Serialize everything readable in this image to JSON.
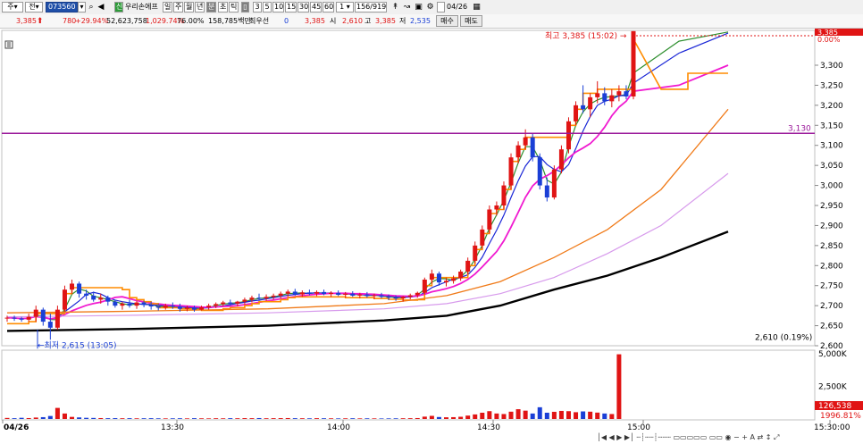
{
  "toolbar": {
    "market": "주",
    "mode": "전",
    "code": "073560",
    "search_icon": "magnifier-icon",
    "speaker_icon": "speaker-icon",
    "badge": "신",
    "stock_name": "우리손에프",
    "periods": [
      "일",
      "주",
      "월",
      "년",
      "분",
      "초",
      "틱"
    ],
    "active_period": "분",
    "page_icon": "page-icon",
    "intervals": [
      "3",
      "5",
      "10",
      "15",
      "30",
      "45",
      "60"
    ],
    "interval_select": "1",
    "count": "156",
    "total": "919",
    "tools": [
      "chart-type-icon",
      "link-icon",
      "save-icon",
      "gear-icon"
    ],
    "checkbox_date": "04/26",
    "calendar_icon": "calendar-icon"
  },
  "quote": {
    "price": "3,385",
    "change": "780",
    "change_pct": "+29.94%",
    "volume": "52,623,758",
    "volume_pct": "1,029.74%",
    "ratio": "76.00%",
    "amount": "158,785백만",
    "priority_label": "최우선",
    "priority_value": "0",
    "last": "3,385",
    "open_label": "시",
    "open": "2,610",
    "high_label": "고",
    "high": "3,385",
    "low_label": "저",
    "low": "2,535",
    "buy_label": "매수",
    "sell_label": "매도"
  },
  "chart_data": {
    "type": "candlestick",
    "date": "04/26",
    "x_ticks": [
      "04/26",
      "13:30",
      "14:00",
      "14:30",
      "15:00",
      "15:30:00"
    ],
    "y_ticks": [
      "3,300",
      "3,250",
      "3,200",
      "3,150",
      "3,100",
      "3,050",
      "3,000",
      "2,950",
      "2,900",
      "2,850",
      "2,800",
      "2,750",
      "2,700",
      "2,650",
      "2,600"
    ],
    "ylim": [
      2600,
      3385
    ],
    "hline": {
      "value": 3130,
      "label": "3,130",
      "color": "#9b1a9b"
    },
    "high_marker": {
      "label": "최고 3,385 (15:02)",
      "value": 3385
    },
    "low_marker": {
      "label": "최저 2,615 (13:05)",
      "value": 2615
    },
    "open_label": "2,610 (0.19%)",
    "top_price_box": "3,385",
    "top_pct_box": "0.00%",
    "volume_ticks": [
      "5,000K",
      "2,500K"
    ],
    "volume_last": "126,538",
    "volume_pct_label": "1996.81%",
    "candles": [
      [
        2668,
        2675,
        2660,
        2670
      ],
      [
        2670,
        2675,
        2662,
        2668
      ],
      [
        2668,
        2672,
        2660,
        2665
      ],
      [
        2665,
        2680,
        2660,
        2672
      ],
      [
        2672,
        2700,
        2660,
        2690
      ],
      [
        2690,
        2695,
        2650,
        2660
      ],
      [
        2660,
        2680,
        2615,
        2645
      ],
      [
        2645,
        2700,
        2640,
        2690
      ],
      [
        2690,
        2750,
        2685,
        2740
      ],
      [
        2740,
        2765,
        2730,
        2755
      ],
      [
        2755,
        2760,
        2720,
        2730
      ],
      [
        2730,
        2740,
        2715,
        2725
      ],
      [
        2725,
        2735,
        2710,
        2715
      ],
      [
        2715,
        2730,
        2705,
        2720
      ],
      [
        2720,
        2725,
        2700,
        2710
      ],
      [
        2710,
        2715,
        2695,
        2700
      ],
      [
        2700,
        2710,
        2690,
        2705
      ],
      [
        2705,
        2715,
        2695,
        2700
      ],
      [
        2700,
        2712,
        2692,
        2708
      ],
      [
        2708,
        2712,
        2696,
        2702
      ],
      [
        2702,
        2710,
        2690,
        2698
      ],
      [
        2698,
        2705,
        2688,
        2695
      ],
      [
        2695,
        2705,
        2690,
        2700
      ],
      [
        2700,
        2708,
        2692,
        2698
      ],
      [
        2698,
        2705,
        2685,
        2692
      ],
      [
        2692,
        2700,
        2686,
        2695
      ],
      [
        2695,
        2700,
        2685,
        2690
      ],
      [
        2690,
        2700,
        2688,
        2696
      ],
      [
        2696,
        2705,
        2690,
        2700
      ],
      [
        2700,
        2708,
        2694,
        2704
      ],
      [
        2704,
        2712,
        2698,
        2708
      ],
      [
        2708,
        2715,
        2700,
        2705
      ],
      [
        2705,
        2712,
        2698,
        2710
      ],
      [
        2710,
        2720,
        2703,
        2715
      ],
      [
        2715,
        2725,
        2708,
        2720
      ],
      [
        2720,
        2730,
        2712,
        2718
      ],
      [
        2718,
        2728,
        2712,
        2722
      ],
      [
        2722,
        2730,
        2715,
        2725
      ],
      [
        2725,
        2735,
        2718,
        2730
      ],
      [
        2730,
        2740,
        2722,
        2735
      ],
      [
        2735,
        2742,
        2725,
        2728
      ],
      [
        2728,
        2738,
        2722,
        2733
      ],
      [
        2733,
        2740,
        2726,
        2730
      ],
      [
        2730,
        2738,
        2724,
        2734
      ],
      [
        2734,
        2740,
        2726,
        2729
      ],
      [
        2729,
        2736,
        2722,
        2732
      ],
      [
        2732,
        2738,
        2724,
        2727
      ],
      [
        2727,
        2734,
        2720,
        2730
      ],
      [
        2730,
        2736,
        2722,
        2725
      ],
      [
        2725,
        2732,
        2718,
        2728
      ],
      [
        2728,
        2734,
        2720,
        2724
      ],
      [
        2724,
        2730,
        2716,
        2726
      ],
      [
        2726,
        2732,
        2718,
        2722
      ],
      [
        2722,
        2728,
        2714,
        2720
      ],
      [
        2720,
        2726,
        2712,
        2718
      ],
      [
        2718,
        2724,
        2710,
        2722
      ],
      [
        2722,
        2730,
        2716,
        2726
      ],
      [
        2726,
        2735,
        2720,
        2732
      ],
      [
        2732,
        2770,
        2728,
        2765
      ],
      [
        2765,
        2790,
        2755,
        2780
      ],
      [
        2780,
        2785,
        2750,
        2758
      ],
      [
        2758,
        2770,
        2748,
        2762
      ],
      [
        2762,
        2775,
        2755,
        2768
      ],
      [
        2768,
        2790,
        2762,
        2785
      ],
      [
        2785,
        2820,
        2778,
        2812
      ],
      [
        2812,
        2860,
        2805,
        2850
      ],
      [
        2850,
        2900,
        2842,
        2890
      ],
      [
        2890,
        2950,
        2880,
        2940
      ],
      [
        2940,
        2960,
        2925,
        2950
      ],
      [
        2950,
        3010,
        2940,
        3000
      ],
      [
        3000,
        3080,
        2990,
        3070
      ],
      [
        3070,
        3110,
        3055,
        3100
      ],
      [
        3100,
        3140,
        3090,
        3120
      ],
      [
        3120,
        3130,
        3060,
        3070
      ],
      [
        3070,
        3080,
        2990,
        3000
      ],
      [
        3000,
        3020,
        2960,
        2970
      ],
      [
        2970,
        3050,
        2965,
        3040
      ],
      [
        3040,
        3100,
        3030,
        3090
      ],
      [
        3090,
        3170,
        3080,
        3160
      ],
      [
        3160,
        3210,
        3150,
        3200
      ],
      [
        3200,
        3250,
        3180,
        3190
      ],
      [
        3190,
        3230,
        3170,
        3220
      ],
      [
        3220,
        3260,
        3205,
        3230
      ],
      [
        3230,
        3245,
        3200,
        3210
      ],
      [
        3210,
        3240,
        3195,
        3225
      ],
      [
        3225,
        3250,
        3210,
        3235
      ],
      [
        3235,
        3250,
        3215,
        3222
      ],
      [
        3222,
        3385,
        3215,
        3385
      ]
    ],
    "volumes": [
      80,
      60,
      90,
      70,
      110,
      140,
      230,
      850,
      420,
      160,
      120,
      90,
      80,
      70,
      60,
      65,
      55,
      60,
      50,
      55,
      60,
      50,
      45,
      50,
      55,
      45,
      60,
      50,
      45,
      55,
      50,
      60,
      55,
      65,
      60,
      70,
      55,
      60,
      65,
      70,
      60,
      55,
      50,
      60,
      55,
      50,
      45,
      50,
      55,
      45,
      50,
      45,
      40,
      45,
      50,
      55,
      60,
      70,
      180,
      240,
      150,
      130,
      140,
      170,
      260,
      350,
      480,
      600,
      420,
      380,
      560,
      750,
      640,
      420,
      900,
      480,
      550,
      620,
      600,
      520,
      580,
      560,
      490,
      420,
      380,
      4960
    ],
    "ma_lines": [
      {
        "name": "ma5",
        "color": "#2f8f2f"
      },
      {
        "name": "ma10",
        "color": "#1a26d6"
      },
      {
        "name": "ma20",
        "color": "#f01ad0"
      },
      {
        "name": "ma60",
        "color": "#f07a18"
      },
      {
        "name": "ma120",
        "color": "#d79aec"
      },
      {
        "name": "ma240",
        "color": "#000000"
      },
      {
        "name": "envelope",
        "color": "#ff8c00"
      }
    ]
  }
}
